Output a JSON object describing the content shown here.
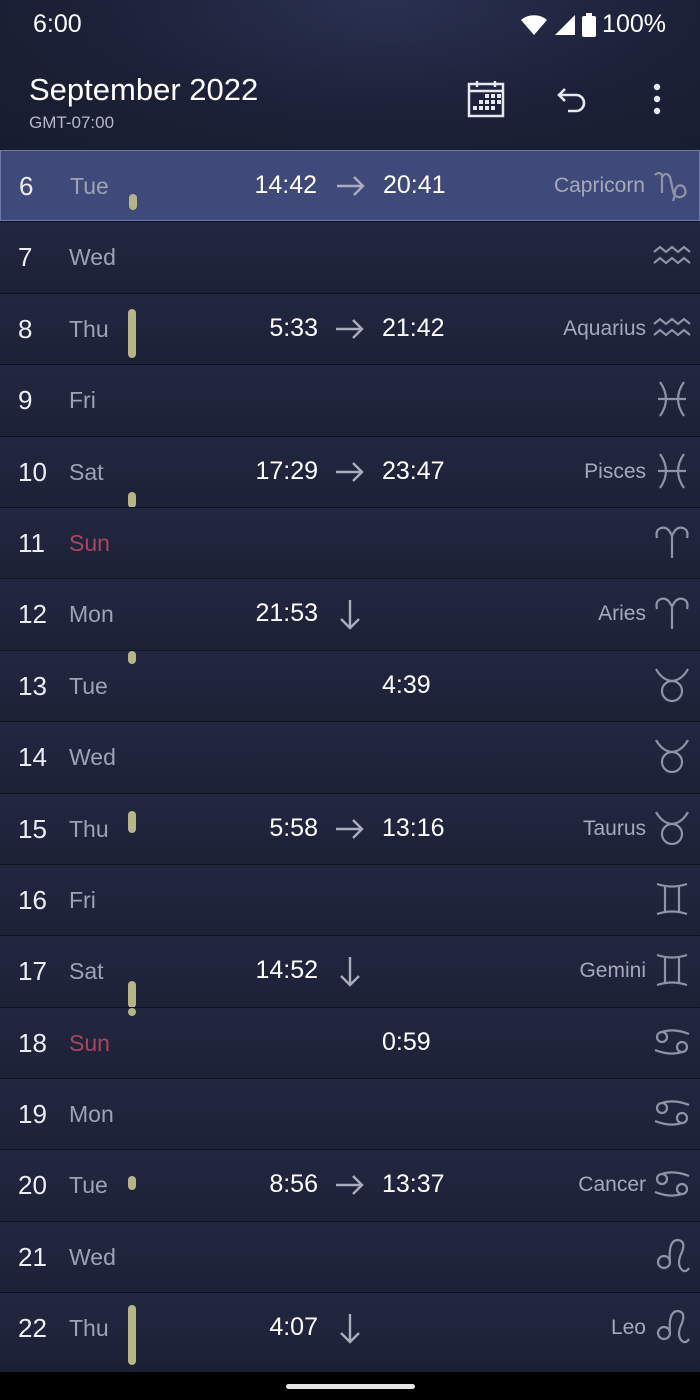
{
  "status": {
    "time": "6:00",
    "battery": "100%"
  },
  "header": {
    "title": "September 2022",
    "timezone": "GMT-07:00"
  },
  "rows": [
    {
      "day": "6",
      "weekday": "Tue",
      "sunday": false,
      "selected": true,
      "rise": "14:42",
      "arrow": "right",
      "set": "20:41",
      "sign": "Capricorn",
      "glyph": "capricorn-icon",
      "moon": [
        0.6,
        0.82
      ]
    },
    {
      "day": "7",
      "weekday": "Wed",
      "sunday": false,
      "selected": false,
      "rise": "",
      "arrow": "",
      "set": "",
      "sign": "",
      "glyph": "aquarius-icon",
      "moon": null
    },
    {
      "day": "8",
      "weekday": "Thu",
      "sunday": false,
      "selected": false,
      "rise": "5:33",
      "arrow": "right",
      "set": "21:42",
      "sign": "Aquarius",
      "glyph": "aquarius-icon",
      "moon": [
        0.22,
        0.9
      ]
    },
    {
      "day": "9",
      "weekday": "Fri",
      "sunday": false,
      "selected": false,
      "rise": "",
      "arrow": "",
      "set": "",
      "sign": "",
      "glyph": "pisces-icon",
      "moon": null
    },
    {
      "day": "10",
      "weekday": "Sat",
      "sunday": false,
      "selected": false,
      "rise": "17:29",
      "arrow": "right",
      "set": "23:47",
      "sign": "Pisces",
      "glyph": "pisces-icon",
      "moon": [
        0.78,
        1.0
      ]
    },
    {
      "day": "11",
      "weekday": "Sun",
      "sunday": true,
      "selected": false,
      "rise": "",
      "arrow": "",
      "set": "",
      "sign": "",
      "glyph": "aries-icon",
      "moon": null
    },
    {
      "day": "12",
      "weekday": "Mon",
      "sunday": false,
      "selected": false,
      "rise": "21:53",
      "arrow": "down",
      "set": "",
      "sign": "Aries",
      "glyph": "aries-icon",
      "moon": null
    },
    {
      "day": "13",
      "weekday": "Tue",
      "sunday": false,
      "selected": false,
      "rise": "",
      "arrow": "",
      "set": "4:39",
      "sign": "",
      "glyph": "taurus-icon",
      "moon": [
        -0.05,
        0.18
      ]
    },
    {
      "day": "14",
      "weekday": "Wed",
      "sunday": false,
      "selected": false,
      "rise": "",
      "arrow": "",
      "set": "",
      "sign": "",
      "glyph": "taurus-icon",
      "moon": null
    },
    {
      "day": "15",
      "weekday": "Thu",
      "sunday": false,
      "selected": false,
      "rise": "5:58",
      "arrow": "right",
      "set": "13:16",
      "sign": "Taurus",
      "glyph": "taurus-icon",
      "moon": [
        0.25,
        0.55
      ]
    },
    {
      "day": "16",
      "weekday": "Fri",
      "sunday": false,
      "selected": false,
      "rise": "",
      "arrow": "",
      "set": "",
      "sign": "",
      "glyph": "gemini-icon",
      "moon": null
    },
    {
      "day": "17",
      "weekday": "Sat",
      "sunday": false,
      "selected": false,
      "rise": "14:52",
      "arrow": "down",
      "set": "",
      "sign": "Gemini",
      "glyph": "gemini-icon",
      "moon": [
        0.62,
        1.0
      ]
    },
    {
      "day": "18",
      "weekday": "Sun",
      "sunday": true,
      "selected": false,
      "rise": "",
      "arrow": "",
      "set": "0:59",
      "sign": "",
      "glyph": "cancer-icon",
      "moon": [
        -0.05,
        0.04
      ]
    },
    {
      "day": "19",
      "weekday": "Mon",
      "sunday": false,
      "selected": false,
      "rise": "",
      "arrow": "",
      "set": "",
      "sign": "",
      "glyph": "cancer-icon",
      "moon": null
    },
    {
      "day": "20",
      "weekday": "Tue",
      "sunday": false,
      "selected": false,
      "rise": "8:56",
      "arrow": "right",
      "set": "13:37",
      "sign": "Cancer",
      "glyph": "cancer-icon",
      "moon": [
        0.36,
        0.56
      ]
    },
    {
      "day": "21",
      "weekday": "Wed",
      "sunday": false,
      "selected": false,
      "rise": "",
      "arrow": "",
      "set": "",
      "sign": "",
      "glyph": "leo-icon",
      "moon": null
    },
    {
      "day": "22",
      "weekday": "Thu",
      "sunday": false,
      "selected": false,
      "rise": "4:07",
      "arrow": "down",
      "set": "",
      "sign": "Leo",
      "glyph": "leo-icon",
      "moon": [
        0.17,
        1.0
      ]
    }
  ],
  "colors": {
    "moon_bar": "#b6b585",
    "sunday": "#a6475e",
    "selected_row": "#404a7a"
  }
}
